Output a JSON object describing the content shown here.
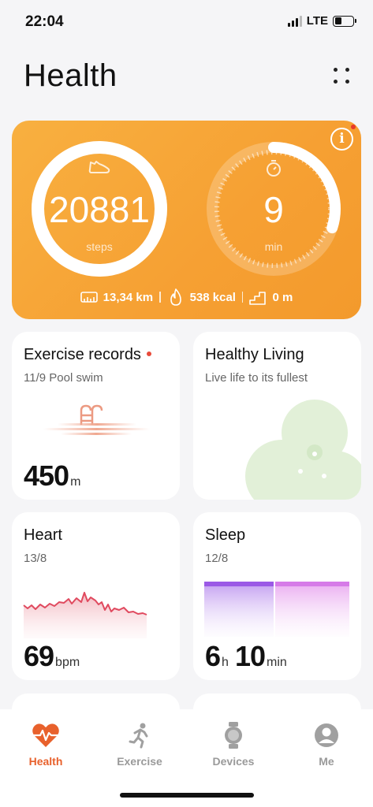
{
  "status_bar": {
    "time": "22:04",
    "network": "LTE",
    "battery_level": 0.38
  },
  "header": {
    "title": "Health"
  },
  "activity": {
    "steps_value": "20881",
    "steps_unit": "steps",
    "steps_progress": 1.0,
    "exercise_value": "9",
    "exercise_unit": "min",
    "exercise_progress": 0.3,
    "distance": "13,34 km",
    "calories": "538 kcal",
    "floors": "0 m",
    "info_label": "i"
  },
  "cards": {
    "exercise": {
      "title": "Exercise records",
      "subtitle": "11/9 Pool swim",
      "value": "450",
      "unit": "m"
    },
    "healthy_living": {
      "title": "Healthy Living",
      "subtitle": "Live life to its fullest"
    },
    "heart": {
      "title": "Heart",
      "subtitle": "13/8",
      "value": "69",
      "unit": "bpm"
    },
    "sleep": {
      "title": "Sleep",
      "subtitle": "12/8",
      "hours": "6",
      "hours_unit": "h",
      "minutes": "10",
      "minutes_unit": "min"
    }
  },
  "nav": {
    "items": [
      {
        "label": "Health",
        "icon": "heart-pulse-icon",
        "active": true
      },
      {
        "label": "Exercise",
        "icon": "running-icon",
        "active": false
      },
      {
        "label": "Devices",
        "icon": "watch-icon",
        "active": false
      },
      {
        "label": "Me",
        "icon": "avatar-icon",
        "active": false
      }
    ]
  },
  "colors": {
    "accent": "#e8612c",
    "card_orange": "#f6a033",
    "heart_line": "#e04a5f",
    "sleep_deep": "#9b59e6",
    "sleep_light": "#d67be8"
  }
}
